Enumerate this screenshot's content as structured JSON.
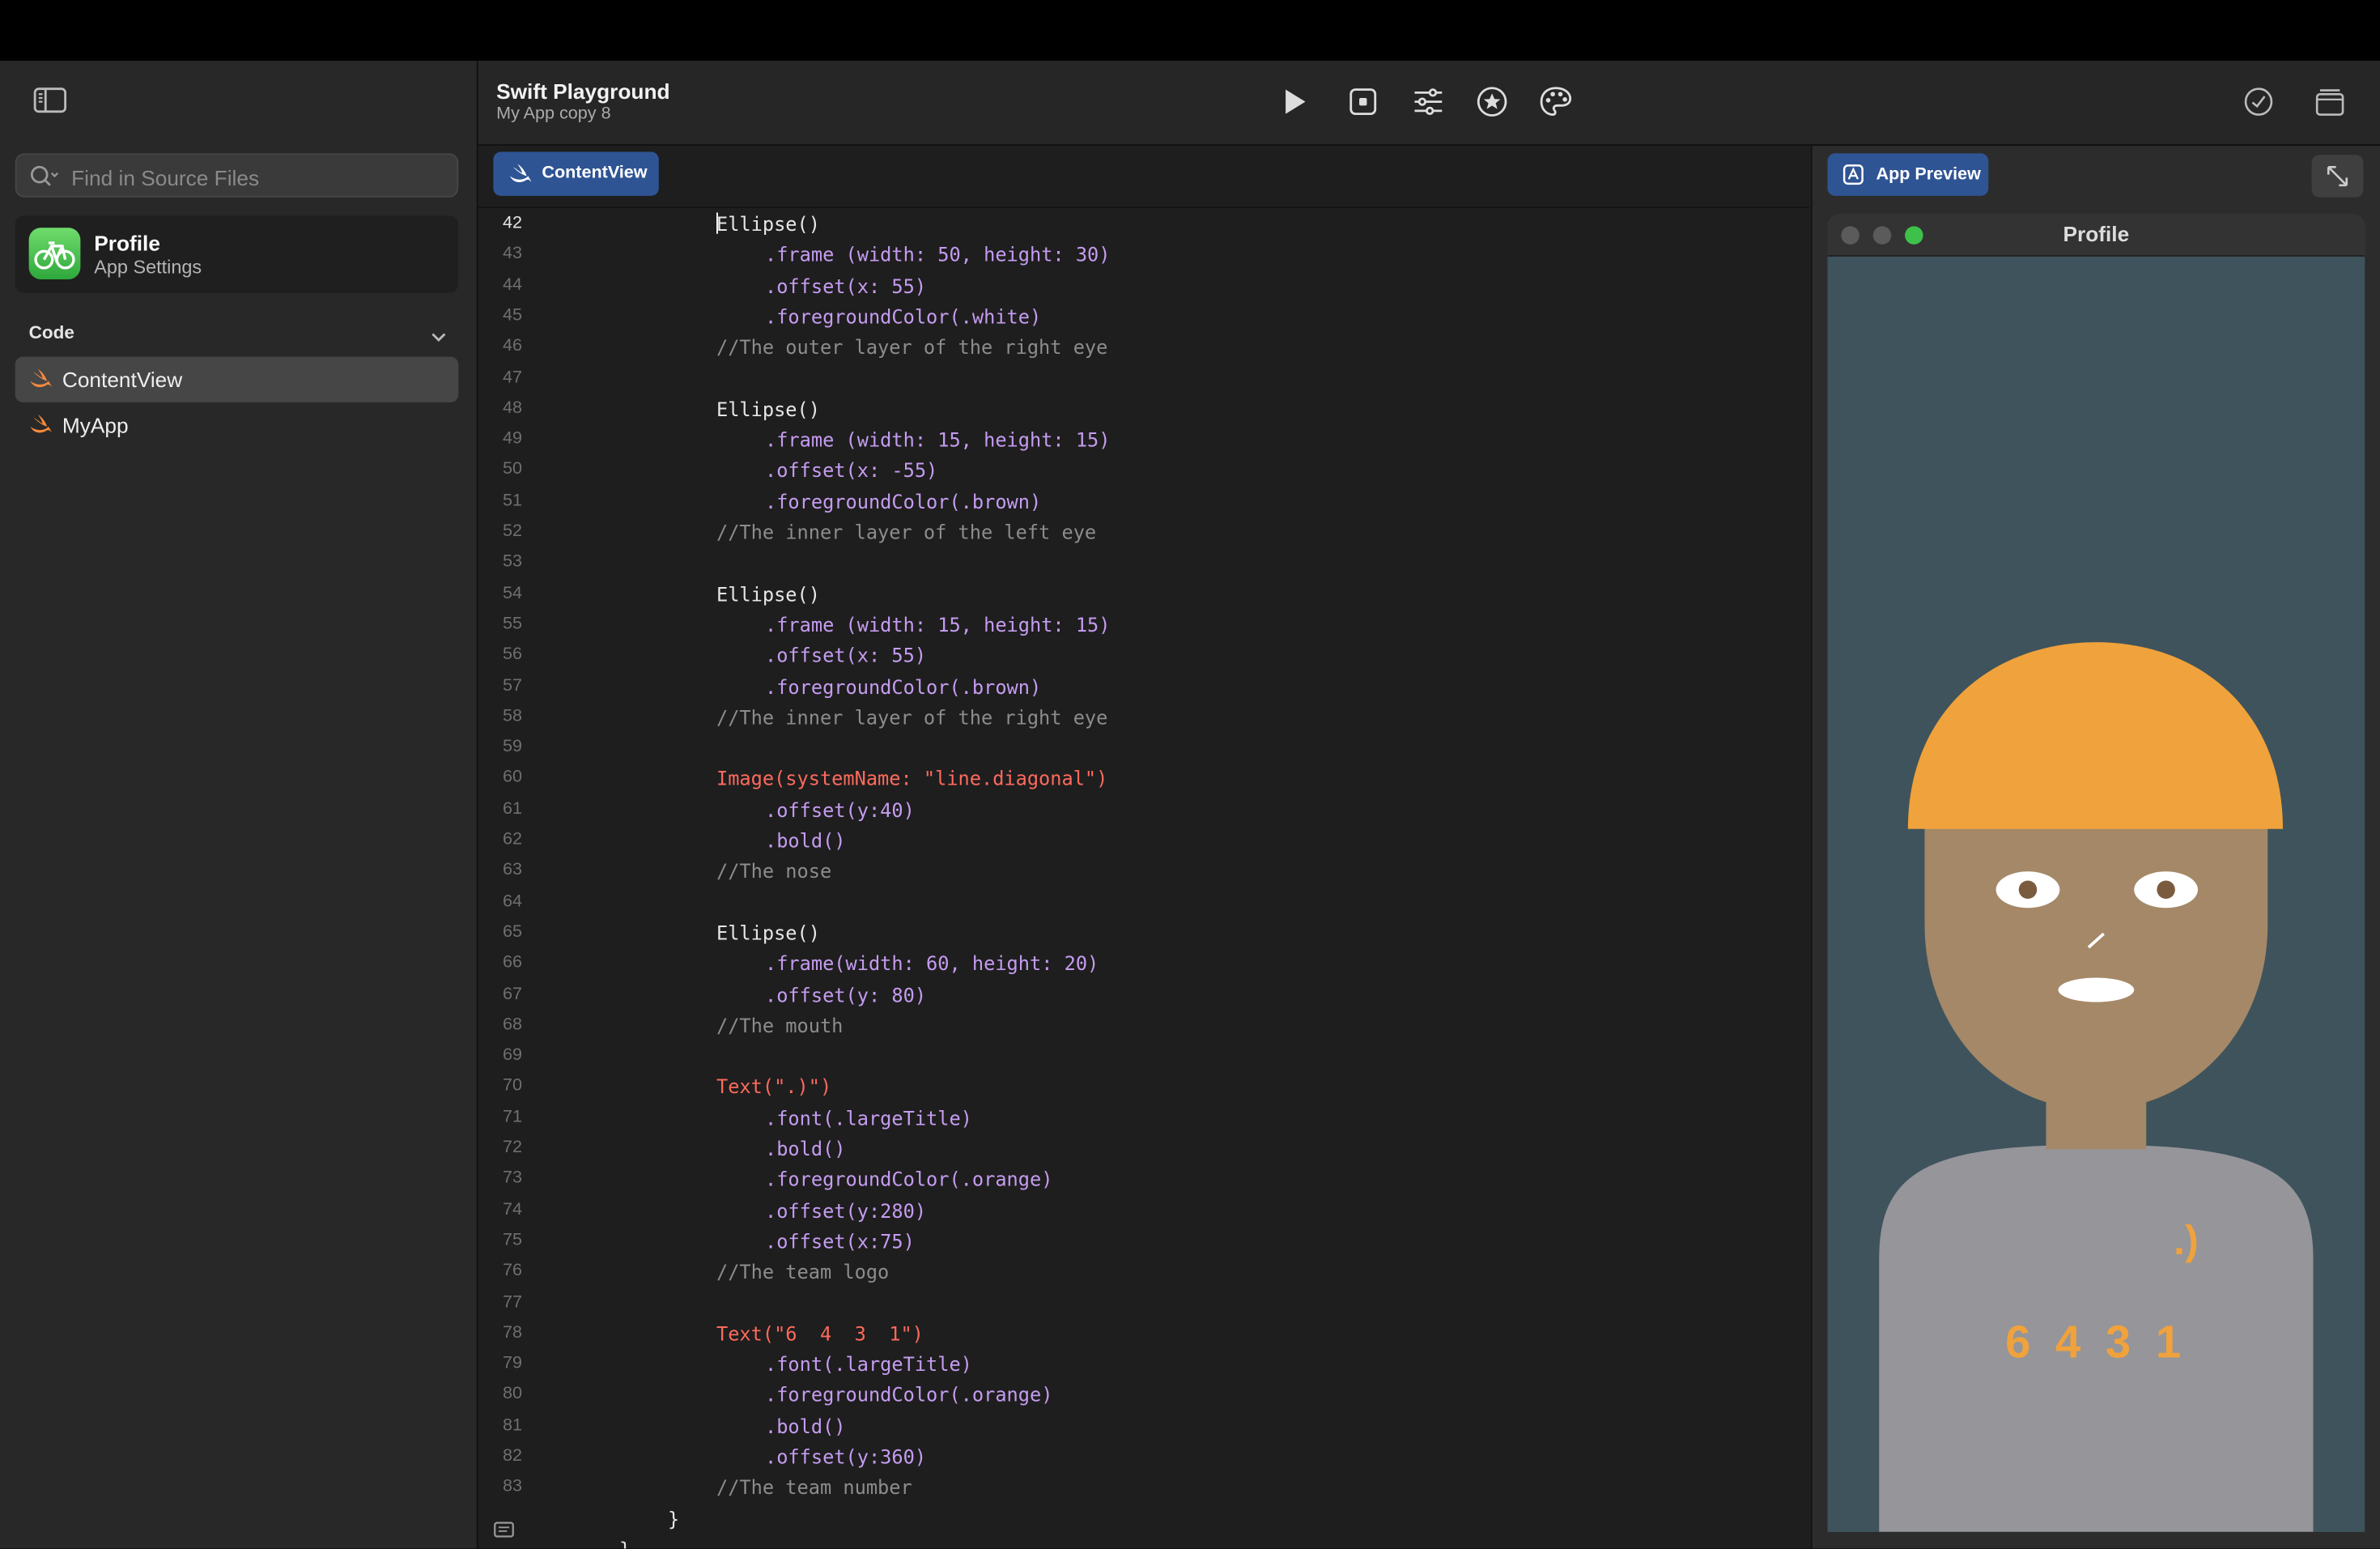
{
  "app": {
    "title": "Swift Playground",
    "subtitle": "My App copy 8"
  },
  "sidebar": {
    "search_placeholder": "Find in Source Files",
    "profile_name": "Profile",
    "profile_sub": "App Settings",
    "code_header": "Code",
    "files": [
      "ContentView",
      "MyApp"
    ]
  },
  "editor": {
    "tab_label": "ContentView",
    "lines": [
      {
        "n": "42"
      },
      {
        "n": "43"
      },
      {
        "n": "44"
      },
      {
        "n": "45"
      },
      {
        "n": "46"
      },
      {
        "n": "47"
      },
      {
        "n": "48"
      },
      {
        "n": "49"
      },
      {
        "n": "50"
      },
      {
        "n": "51"
      },
      {
        "n": "52"
      },
      {
        "n": "53"
      },
      {
        "n": "54"
      },
      {
        "n": "55"
      },
      {
        "n": "56"
      },
      {
        "n": "57"
      },
      {
        "n": "58"
      },
      {
        "n": "59"
      },
      {
        "n": "60"
      },
      {
        "n": "61"
      },
      {
        "n": "62"
      },
      {
        "n": "63"
      },
      {
        "n": "64"
      },
      {
        "n": "65"
      },
      {
        "n": "66"
      },
      {
        "n": "67"
      },
      {
        "n": "68"
      },
      {
        "n": "69"
      },
      {
        "n": "70"
      },
      {
        "n": "71"
      },
      {
        "n": "72"
      },
      {
        "n": "73"
      },
      {
        "n": "74"
      },
      {
        "n": "75"
      },
      {
        "n": "76"
      },
      {
        "n": "77"
      },
      {
        "n": "78"
      },
      {
        "n": "79"
      },
      {
        "n": "80"
      },
      {
        "n": "81"
      },
      {
        "n": "82"
      },
      {
        "n": "83"
      }
    ],
    "code": {
      "ellipse": "Ellipse()",
      "frame_50_30": ".frame (width: 50, height: 30)",
      "offset_x_55": ".offset(x: 55)",
      "fg_white": ".foregroundColor(.white)",
      "cmt_outer_right": "//The outer layer of the right eye",
      "frame_15_15": ".frame (width: 15, height: 15)",
      "offset_x_m55": ".offset(x: -55)",
      "fg_brown": ".foregroundColor(.brown)",
      "cmt_inner_left": "//The inner layer of the left eye",
      "cmt_inner_right": "//The inner layer of the right eye",
      "image_line": "Image(systemName: \"line.diagonal\")",
      "offset_y_40": ".offset(y:40)",
      "bold": ".bold()",
      "cmt_nose": "//The nose",
      "frame_60_20": ".frame(width: 60, height: 20)",
      "offset_y_80": ".offset(y: 80)",
      "cmt_mouth": "//The mouth",
      "text_logo": "Text(\".)\")",
      "font_large": ".font(.largeTitle)",
      "fg_orange": ".foregroundColor(.orange)",
      "offset_y_280": ".offset(y:280)",
      "offset_x_75": ".offset(x:75)",
      "cmt_logo": "//The team logo",
      "text_number": "Text(\"6  4  3  1\")",
      "offset_y_360": ".offset(y:360)",
      "cmt_number": "//The team number",
      "close_brace": "}"
    }
  },
  "preview": {
    "button_label": "App Preview",
    "window_title": "Profile",
    "team_logo": ".)",
    "team_number": "6 4 3 1"
  },
  "colors": {
    "hat": "#f0a23c",
    "skin": "#a48867",
    "shirt": "#95959a",
    "background": "#3f535c",
    "accent": "#2f5493",
    "orange_text": "#f0a23c"
  },
  "icons": [
    "sidebar-toggle-icon",
    "search-icon",
    "bicycle-icon",
    "chevron-down-icon",
    "swift-icon",
    "play-icon",
    "stop-icon",
    "sliders-icon",
    "star-icon",
    "palette-icon",
    "checkmark-circle-icon",
    "windows-icon",
    "expand-icon",
    "comment-icon"
  ]
}
